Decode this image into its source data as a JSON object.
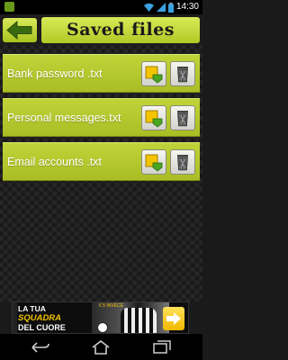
{
  "status_bar": {
    "time": "14:30"
  },
  "header": {
    "title": "Saved files"
  },
  "files": [
    {
      "name": "Bank password .txt"
    },
    {
      "name": "Personal messages.txt"
    },
    {
      "name": "Email accounts .txt"
    }
  ],
  "ad": {
    "line1": "LA TUA",
    "line2": "SQUADRA",
    "line3": "DEL CUORE",
    "small": "€ 5 INVECE"
  },
  "colors": {
    "accent": "#b6cc2e",
    "background": "#1f1f1f",
    "ad_accent": "#f2c200"
  }
}
